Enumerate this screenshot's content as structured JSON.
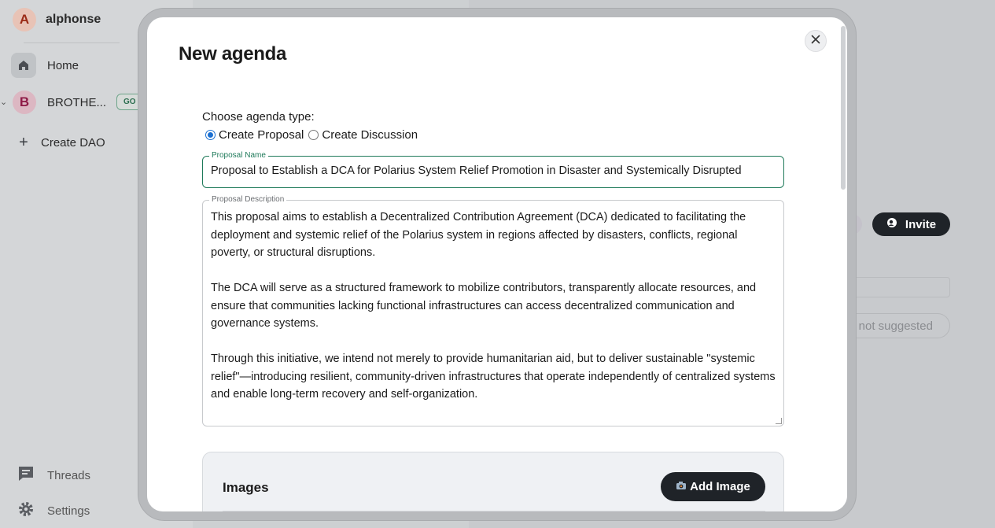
{
  "sidebar": {
    "user": {
      "initial": "A",
      "name": "alphonse"
    },
    "home_label": "Home",
    "dao": {
      "initial": "B",
      "name": "BROTHE...",
      "badge": "GO"
    },
    "create_dao_label": "Create DAO",
    "threads_label": "Threads",
    "settings_label": "Settings"
  },
  "background": {
    "invite_label": "Invite",
    "suggestion_pill": "s not suggested"
  },
  "modal": {
    "title": "New agenda",
    "type_label": "Choose agenda type:",
    "options": [
      {
        "label": "Create Proposal",
        "checked": true
      },
      {
        "label": "Create Discussion",
        "checked": false
      }
    ],
    "proposal_name": {
      "legend": "Proposal Name",
      "value": "Proposal to Establish a DCA for Polarius System Relief Promotion in Disaster and Systemically Disrupted"
    },
    "proposal_description": {
      "legend": "Proposal Description",
      "paragraphs": [
        "This proposal aims to establish a Decentralized Contribution Agreement (DCA) dedicated to facilitating the deployment and systemic relief of the Polarius system in regions affected by disasters, conflicts, regional poverty, or structural disruptions.",
        "The DCA will serve as a structured framework to mobilize contributors, transparently allocate resources, and ensure that communities lacking functional infrastructures can access decentralized communication and governance systems.",
        "Through this initiative, we intend not merely to provide humanitarian aid, but to deliver sustainable \"systemic relief\"—introducing resilient, community-driven infrastructures that operate independently of centralized systems and enable long-term recovery and self-organization."
      ]
    },
    "images": {
      "title": "Images",
      "add_label": "Add Image"
    }
  }
}
